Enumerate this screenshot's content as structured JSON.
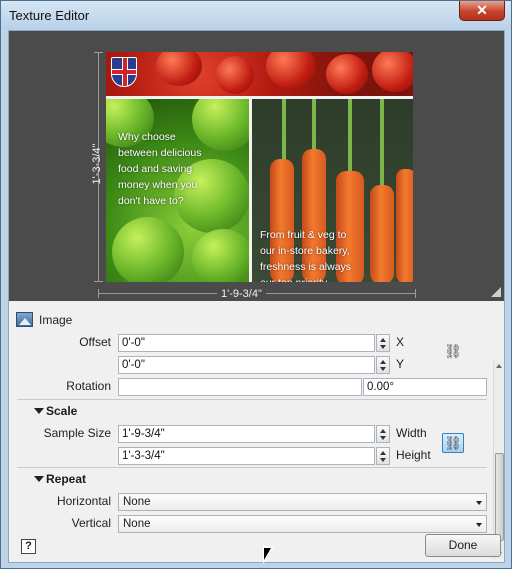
{
  "window": {
    "title": "Texture Editor",
    "close_glyph": "✕"
  },
  "preview": {
    "texture_text": {
      "left": "Why choose between delicious food and saving money when you don't have to?",
      "right": "From fruit & veg to our in-store bakery, freshness is always our top priority"
    },
    "height_dimension": "1'-3-3/4\"",
    "width_dimension": "1'-9-3/4\""
  },
  "image_section": {
    "label": "Image",
    "offset_label": "Offset",
    "offset_x": "0'-0\"",
    "offset_y": "0'-0\"",
    "x_label": "X",
    "y_label": "Y",
    "rotation_label": "Rotation",
    "rotation_value": "",
    "rotation_angle": "0.00°"
  },
  "scale_section": {
    "title": "Scale",
    "sample_size_label": "Sample Size",
    "width_value": "1'-9-3/4\"",
    "height_value": "1'-3-3/4\"",
    "width_label": "Width",
    "height_label": "Height"
  },
  "repeat_section": {
    "title": "Repeat",
    "horizontal_label": "Horizontal",
    "horizontal_value": "None",
    "vertical_label": "Vertical",
    "vertical_value": "None"
  },
  "footer": {
    "help": "?",
    "done": "Done"
  },
  "icons": {
    "flag": "uk-flag-icon",
    "link": "chain-link-icon",
    "image": "image-icon"
  }
}
